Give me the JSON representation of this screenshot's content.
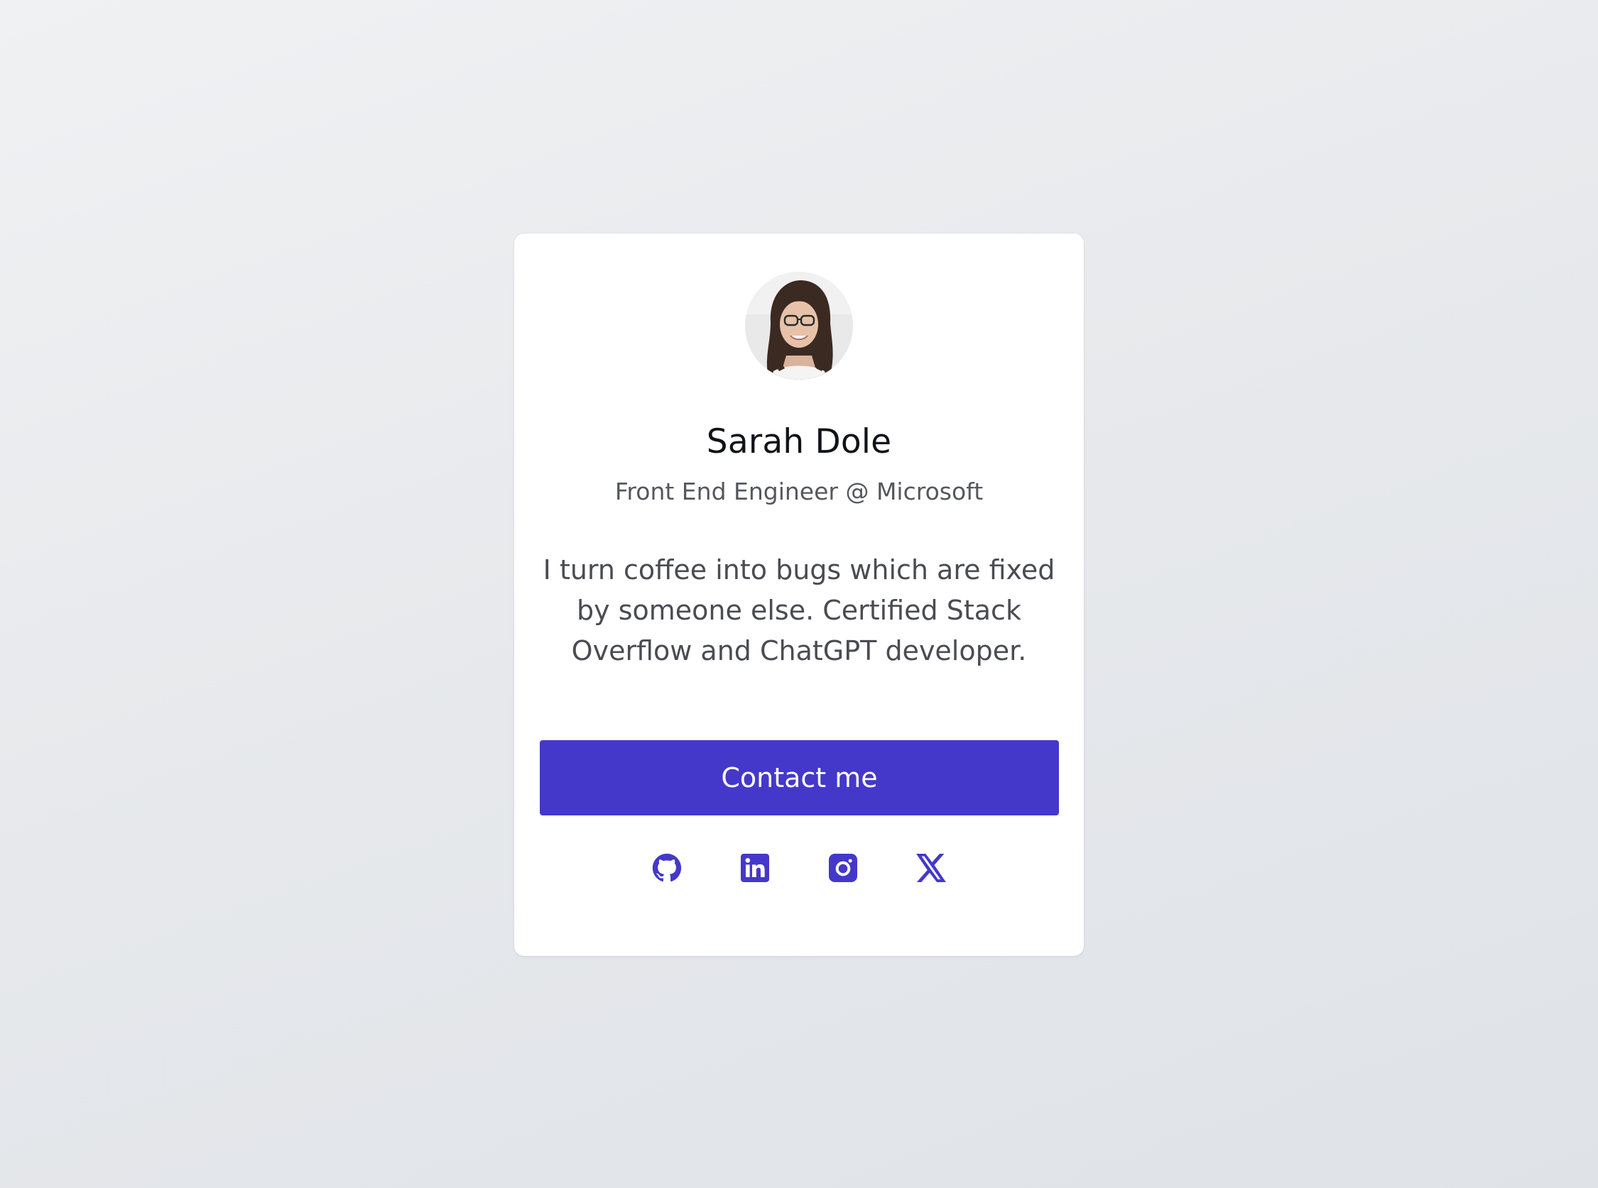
{
  "profile": {
    "name": "Sarah Dole",
    "role": "Front End Engineer @ Microsoft",
    "bio": "I turn coffee into bugs which are fixed by someone else. Certified Stack Overflow and ChatGPT developer.",
    "avatar_icon": "avatar-photo"
  },
  "actions": {
    "contact_label": "Contact me"
  },
  "socials": [
    {
      "icon": "github-icon"
    },
    {
      "icon": "linkedin-icon"
    },
    {
      "icon": "instagram-icon"
    },
    {
      "icon": "x-icon"
    }
  ],
  "colors": {
    "accent": "#4438ca",
    "card": "#ffffff",
    "title": "#111318",
    "muted": "#55575d"
  }
}
